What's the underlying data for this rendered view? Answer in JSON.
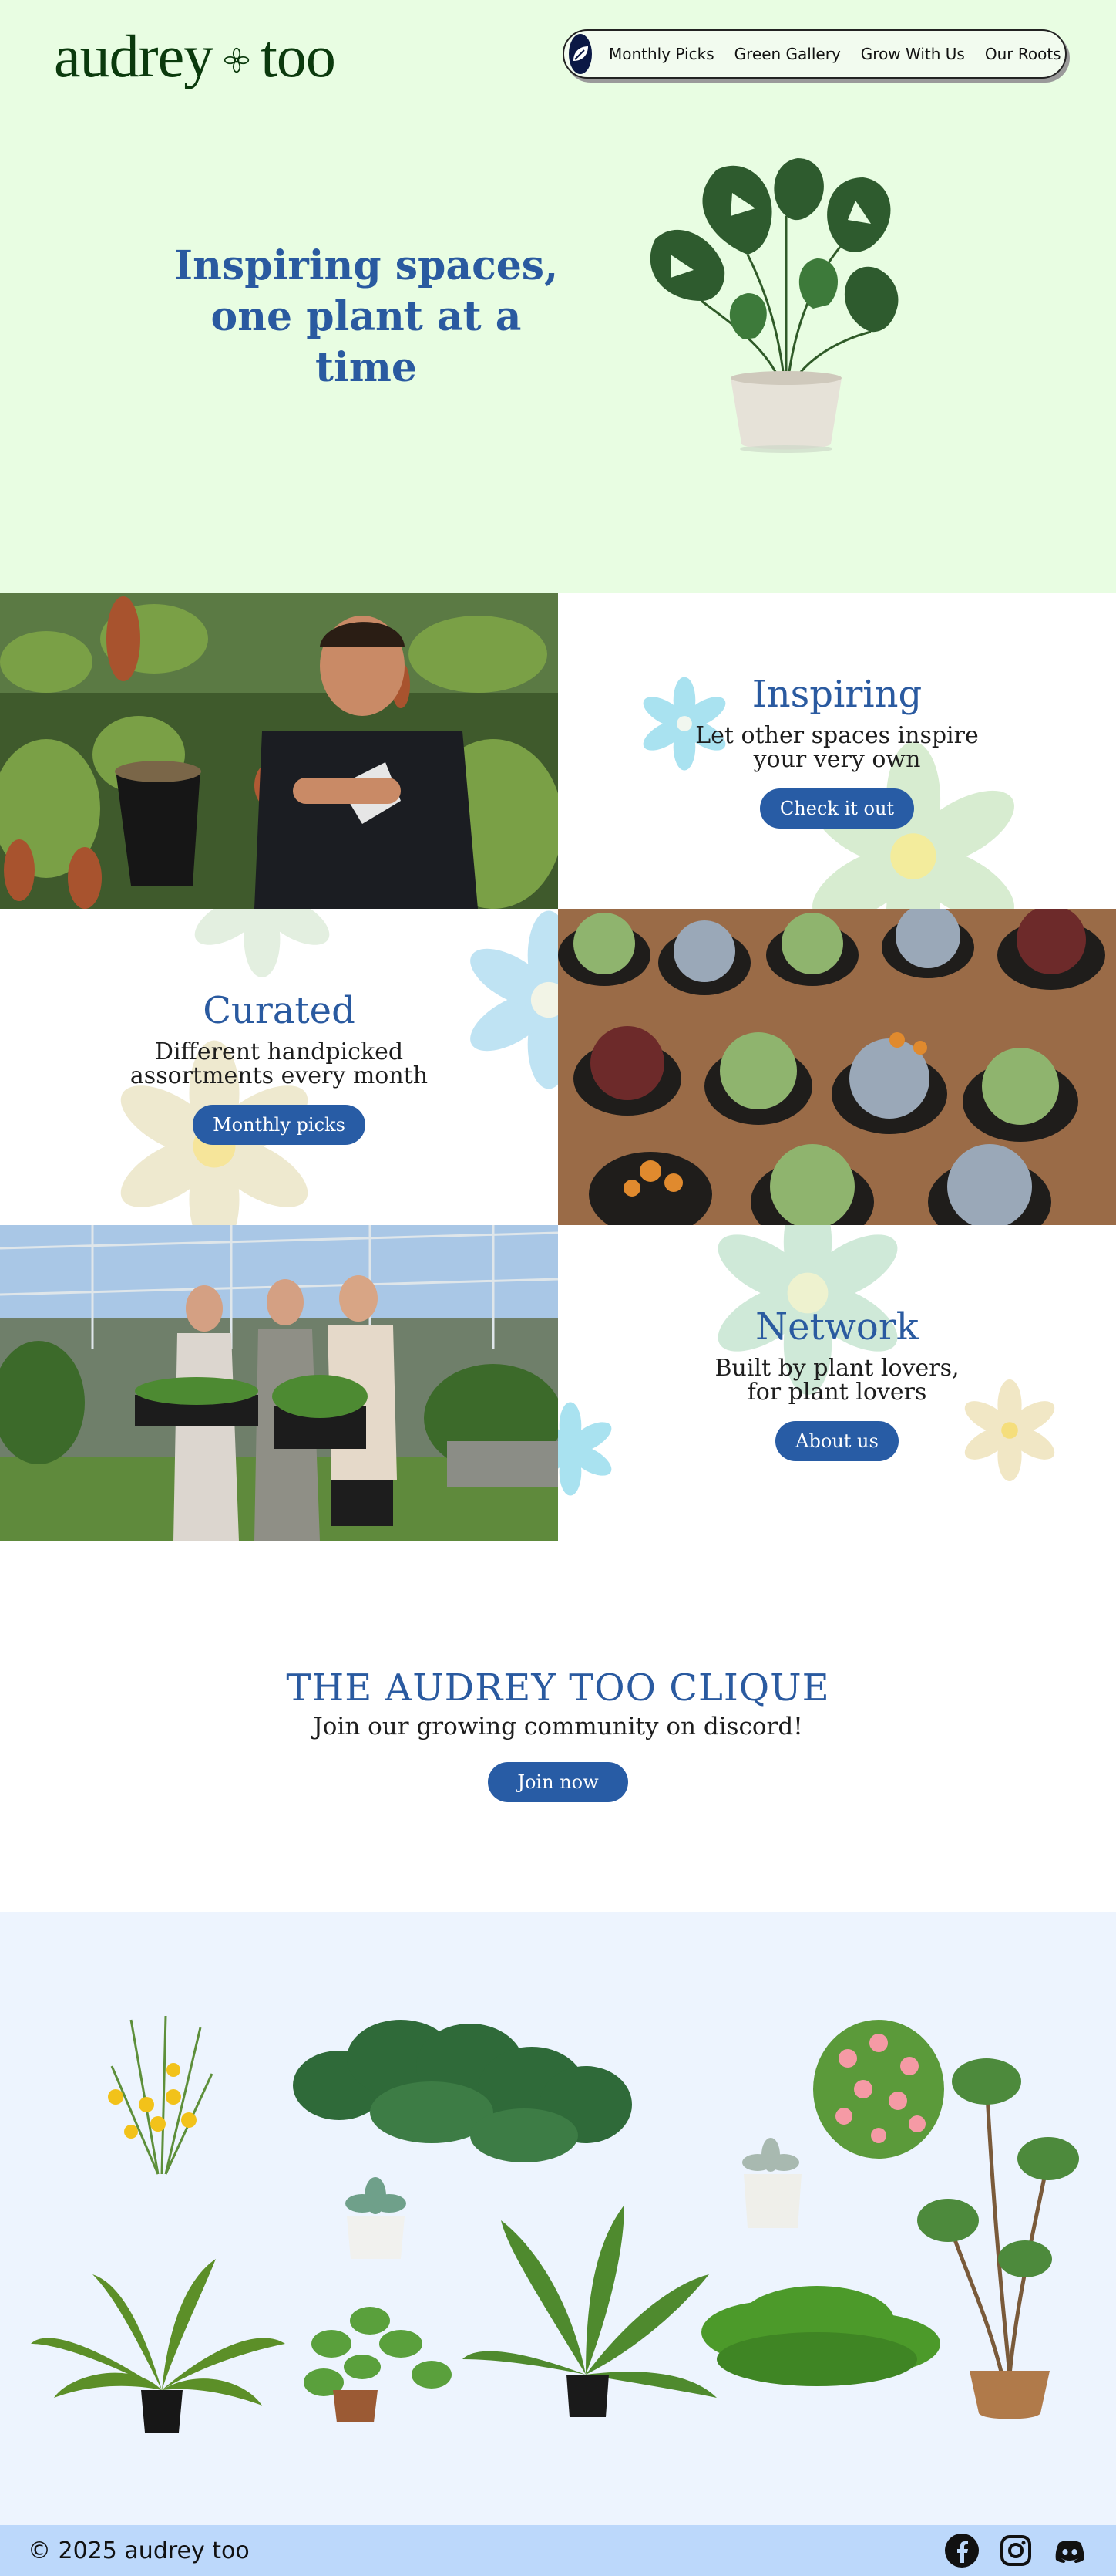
{
  "brand": {
    "name_part1": "audrey",
    "name_part2": "too"
  },
  "nav": {
    "items": [
      {
        "label": "Monthly Picks"
      },
      {
        "label": "Green Gallery"
      },
      {
        "label": "Grow With Us"
      },
      {
        "label": "Our Roots"
      }
    ]
  },
  "hero": {
    "title_line1": "Inspiring spaces,",
    "title_line2": "one plant at a time"
  },
  "features": [
    {
      "title": "Inspiring",
      "line1": "Let other spaces inspire",
      "line2": "your very own",
      "button": "Check it out",
      "photo": "carnivorous-plant-greenhouse-photo"
    },
    {
      "title": "Curated",
      "line1": "Different handpicked",
      "line2": "assortments every month",
      "button": "Monthly picks",
      "photo": "succulents-photo"
    },
    {
      "title": "Network",
      "line1": "Built by plant lovers,",
      "line2": "for plant lovers",
      "button": "About us",
      "photo": "greenhouse-team-photo"
    }
  ],
  "clique": {
    "title": "THE AUDREY TOO CLIQUE",
    "subtitle": "Join our growing community on discord!",
    "button": "Join now"
  },
  "footer": {
    "copyright": "© 2025 audrey too",
    "social": [
      "facebook-icon",
      "instagram-icon",
      "discord-icon"
    ]
  },
  "colors": {
    "hero_bg": "#e8fde2",
    "accent_blue": "#285ca5",
    "gallery_bg": "#edf4fe",
    "footer_bg": "#bcd8fb",
    "logo_green": "#0b3a0d"
  }
}
